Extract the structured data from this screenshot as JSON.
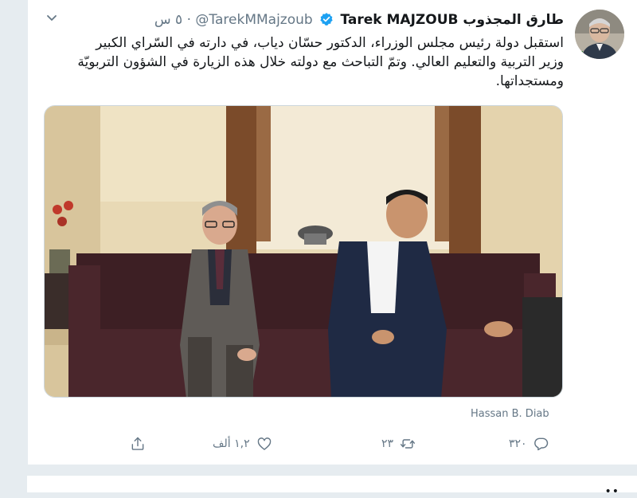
{
  "tweet": {
    "display_name": "طارق المجذوب Tarek MAJZOUB",
    "handle": "@TarekMMajzoub",
    "separator": "·",
    "time": "٥ س",
    "text": "استقبل دولة رئيس مجلس الوزراء، الدكتور حسّان دياب، في دارته في السّراي الكبير وزير التربية والتعليم العالي. وتمّ التباحث مع دولته خلال هذه الزيارة في الشؤون التربويّة ومستجداتها.",
    "media_tag": "Hassan B. Diab"
  },
  "actions": {
    "reply_count": "٣٢٠",
    "retweet_count": "٢٣",
    "like_count": "١,٢ ألف"
  },
  "next_card": {
    "text": "••"
  },
  "colors": {
    "verified": "#1da1f2",
    "muted": "#657786",
    "background": "#e6ecf0"
  },
  "icons": [
    "chevron-down-icon",
    "verified-badge-icon",
    "reply-icon",
    "retweet-icon",
    "like-icon",
    "share-icon"
  ]
}
